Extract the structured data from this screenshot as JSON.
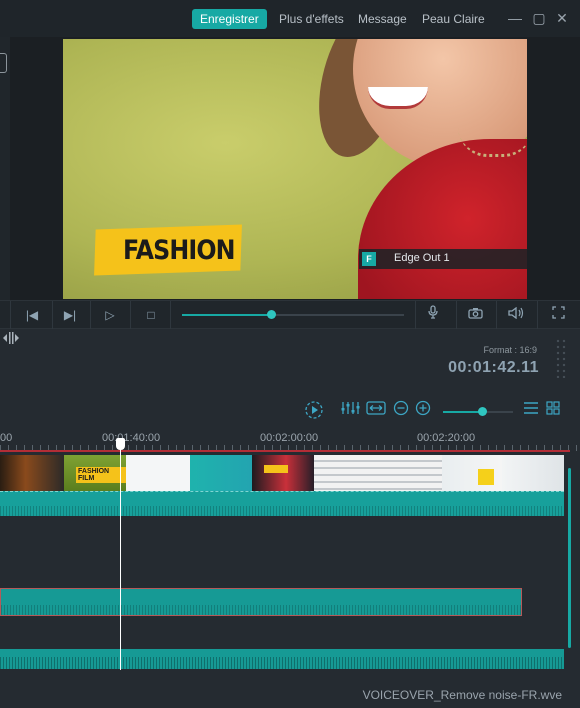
{
  "header": {
    "primary_button": "Enregistrer",
    "menu": [
      "Plus d'effets",
      "Message",
      "Peau Claire"
    ],
    "window_controls": {
      "minimize": "—",
      "maximize": "▢",
      "close": "✕"
    }
  },
  "preview": {
    "title_card": "FASHION",
    "overlay_label": "Edge Out 1",
    "overlay_badge": "F"
  },
  "transport": {
    "prev_frame": "|◀",
    "next_frame": "▶|",
    "play": "▷",
    "stop": "□",
    "progress": 0.4,
    "icons": [
      "microphone-icon",
      "camera-icon",
      "volume-icon",
      "fullscreen-icon"
    ]
  },
  "info": {
    "format": "Format : 16:9",
    "timecode": "00:01:42.11"
  },
  "timeline": {
    "toolbar_icons": [
      "render-preview-icon",
      "audio-mixer-icon",
      "fit-icon",
      "zoom-out-icon",
      "zoom-in-icon",
      "list-view-icon",
      "grid-view-icon"
    ],
    "zoom_level": 0.55,
    "ruler_labels": [
      "00",
      "00:01:40:00",
      "00:02:00:00",
      "00:02:20:00"
    ],
    "fashion_thumb_text": "FASHION FILM",
    "colors": {
      "accent": "#17a9a4",
      "ruler_line": "#b22d36",
      "track": "#17a09b"
    }
  },
  "footer": {
    "filename": "VOICEOVER_Remove noise-FR.wve"
  }
}
